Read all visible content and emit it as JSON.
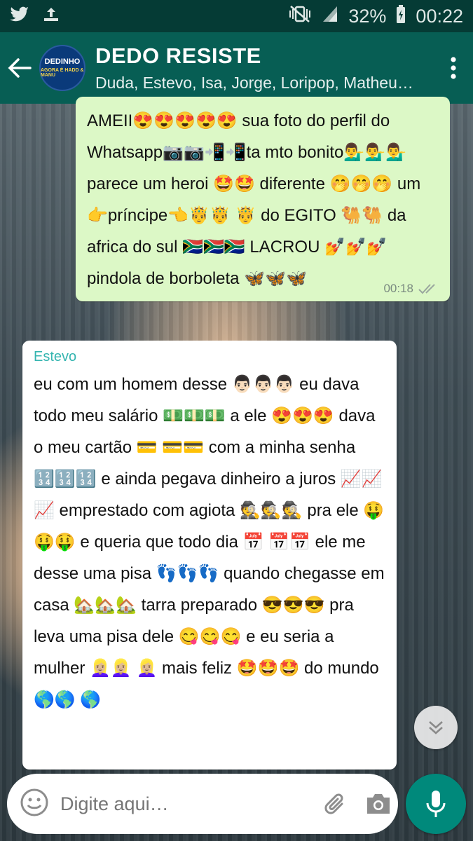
{
  "status_bar": {
    "battery": "32%",
    "time": "00:22",
    "icons": [
      "twitter-icon",
      "upload-icon",
      "mute-vibrate-icon",
      "signal-icon",
      "battery-charging-icon"
    ]
  },
  "header": {
    "avatar_lines": [
      "DEDINHO",
      "AGORA É HADD & MANU"
    ],
    "title": "DEDO RESISTE",
    "participants": "Duda, Estevo, Isa, Jorge, Loripop, Matheu…"
  },
  "messages": [
    {
      "direction": "outgoing",
      "text": "AMEII😍😍😍😍😍 sua foto do perfil do Whatsapp📷📷📲📲ta mto bonito💁‍♂️💁‍♂️💁‍♂️ parece um heroi 🤩🤩 diferente 🤭🤭🤭 um 👉príncipe👈🤴🤴 🤴 do EGITO 🐫🐫 da africa do sul 🇿🇦🇿🇦🇿🇦 LACROU 💅💅💅 pindola de borboleta 🦋🦋🦋",
      "time": "00:18",
      "status": "read"
    },
    {
      "direction": "incoming",
      "sender": "Estevo",
      "text": "eu com um homem desse 👨🏻👨🏻👨🏻 eu dava todo meu salário 💵💵💵 a ele 😍😍😍 dava o meu cartão 💳 💳💳 com a minha senha 🔢🔢🔢 e ainda pegava dinheiro a juros 📈📈📈 emprestado com agiota 🕵🕵🕵 pra ele 🤑🤑🤑 e queria que todo dia 📅 📅📅 ele me desse uma pisa 👣👣👣 quando chegasse em casa 🏡🏡🏡 tarra preparado 😎😎😎 pra leva uma pisa dele 😋😋😋 e eu seria a mulher 👱🏼‍♀️👱🏼‍♀️ 👱🏼‍♀️ mais feliz 🤩🤩🤩 do mundo 🌎🌎 🌎"
    }
  ],
  "composer": {
    "placeholder": "Digite aqui…"
  }
}
